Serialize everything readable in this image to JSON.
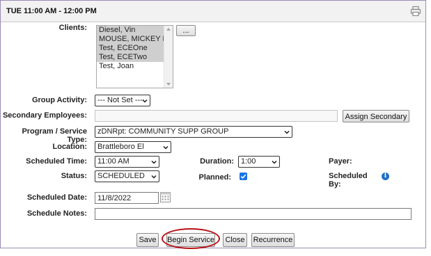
{
  "title": "TUE 11:00 AM - 12:00 PM",
  "icons": {
    "print": "printer-icon",
    "calendar": "calendar-icon",
    "info": "info-icon",
    "check": "checkmark-icon"
  },
  "clients": {
    "label": "Clients:",
    "items": [
      {
        "name": "Diesel, Vin",
        "selected": true
      },
      {
        "name": "MOUSE, MICKEY M",
        "selected": true
      },
      {
        "name": "Test, ECEOne",
        "selected": true
      },
      {
        "name": "Test, ECETwo",
        "selected": true
      },
      {
        "name": "Test, Joan",
        "selected": false
      }
    ],
    "more_button": "..."
  },
  "group_activity": {
    "label": "Group Activity:",
    "value": "--- Not Set ---"
  },
  "secondary_employees": {
    "label": "Secondary Employees:",
    "value": "",
    "button": "Assign Secondary"
  },
  "program": {
    "label": "Program / Service Type:",
    "value": "zDNRpt: COMMUNITY SUPP GROUP"
  },
  "location": {
    "label": "Location:",
    "value": "Brattleboro El"
  },
  "scheduled_time": {
    "label": "Scheduled Time:",
    "value": "11:00 AM"
  },
  "duration": {
    "label": "Duration:",
    "value": "1:00"
  },
  "payer": {
    "label": "Payer:"
  },
  "status": {
    "label": "Status:",
    "value": "SCHEDULED"
  },
  "planned": {
    "label": "Planned:",
    "checked": true
  },
  "scheduled_by": {
    "label": "Scheduled By:"
  },
  "scheduled_date": {
    "label": "Scheduled Date:",
    "value": "11/8/2022"
  },
  "schedule_notes": {
    "label": "Schedule Notes:",
    "value": ""
  },
  "buttons": {
    "save": "Save",
    "begin_service": "Begin Service",
    "close": "Close",
    "recurrence": "Recurrence"
  },
  "highlight_color": "#b80f14",
  "checkbox_color": "#1a73e8"
}
